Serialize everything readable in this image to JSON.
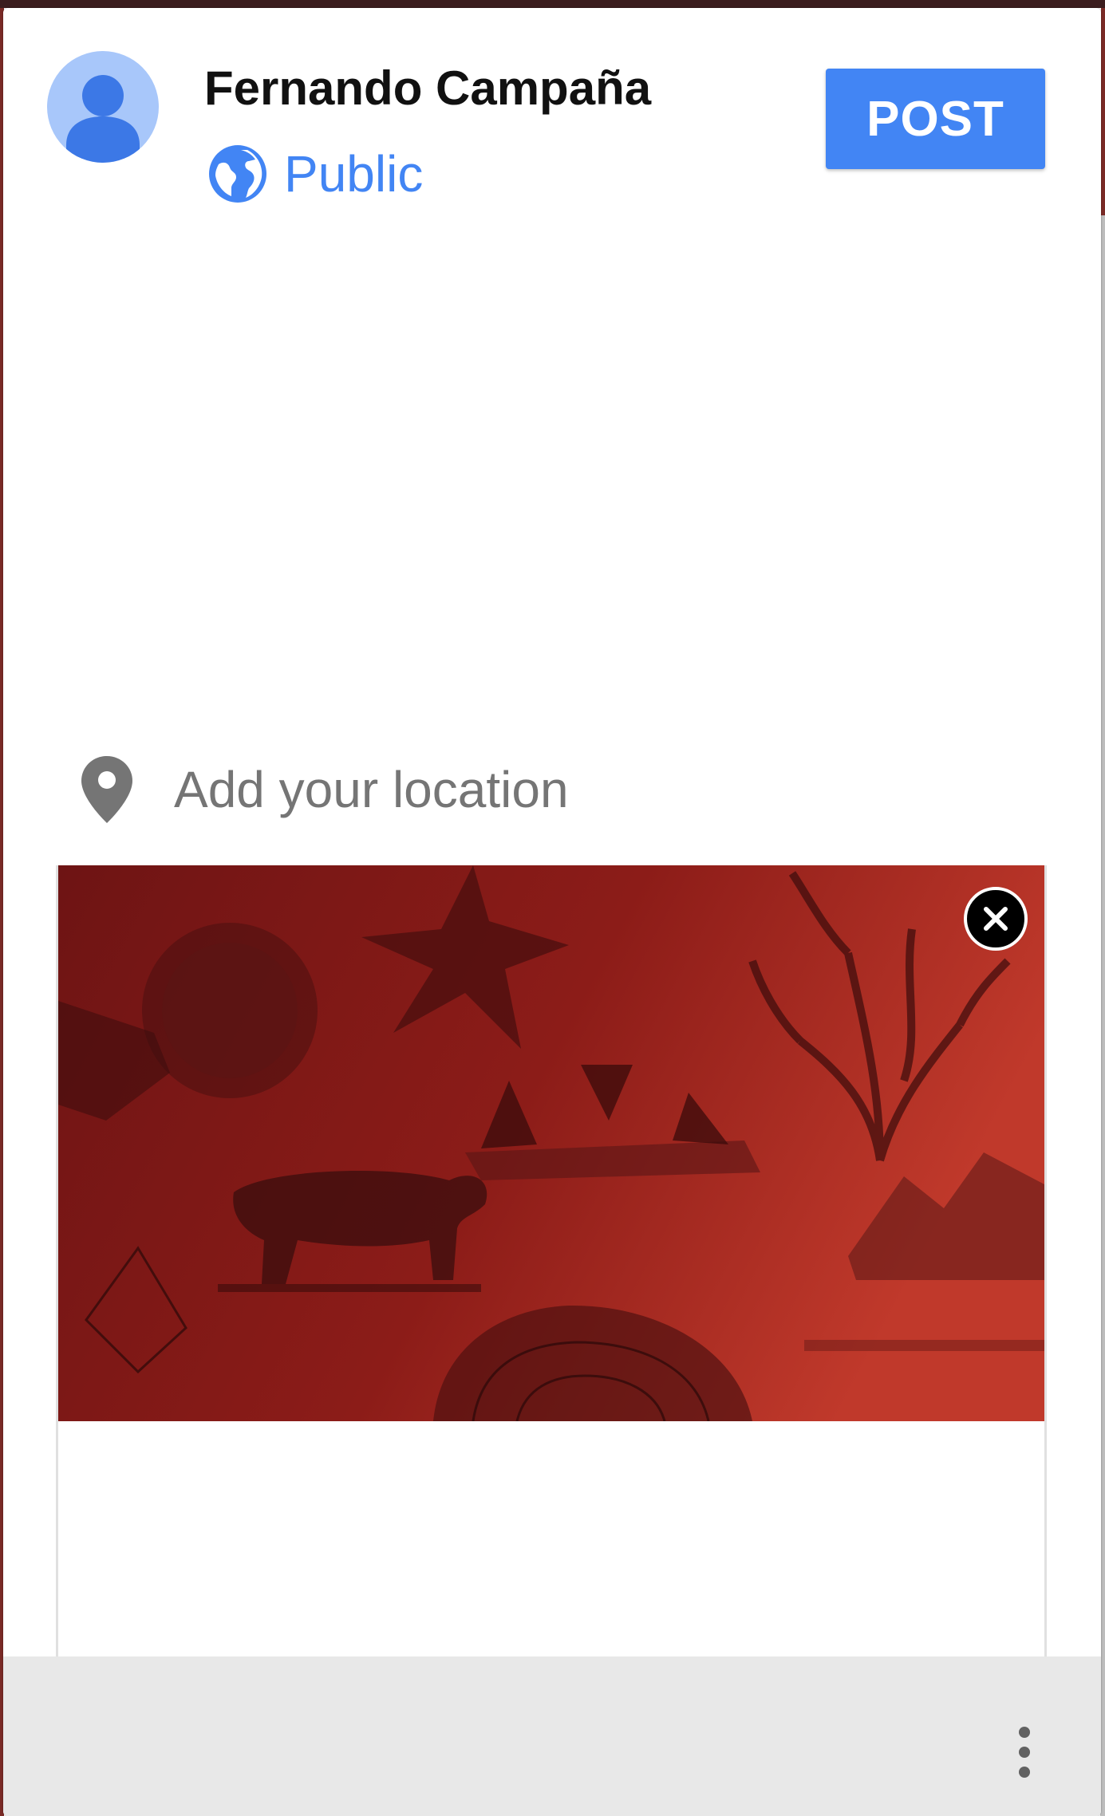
{
  "post": {
    "author_name": "Fernando Campaña",
    "audience_label": "Public",
    "audience_icon": "globe-icon",
    "post_button_label": "POST"
  },
  "location": {
    "icon": "location-pin-icon",
    "label": "Add your location"
  },
  "attachment": {
    "remove_icon": "close-icon"
  },
  "toolbar": {
    "more_icon": "more-vert-icon"
  },
  "colors": {
    "accent_blue": "#4285f4",
    "avatar_bg": "#a8c7fa",
    "avatar_fg": "#3c78e6",
    "attachment_red_dark": "#6e1414",
    "attachment_red_light": "#c0392b",
    "bottom_bar": "#e8e8e8"
  }
}
